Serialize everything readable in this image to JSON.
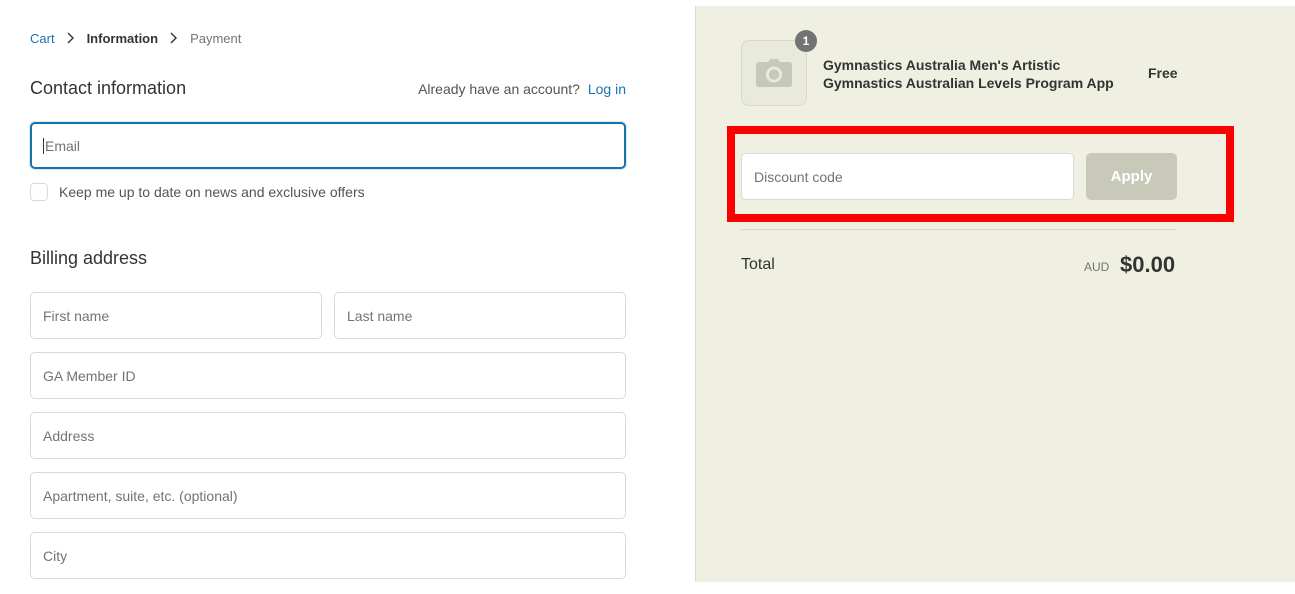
{
  "breadcrumb": {
    "cart": "Cart",
    "information": "Information",
    "payment": "Payment"
  },
  "contact": {
    "title": "Contact information",
    "account_prompt": "Already have an account?",
    "login_label": "Log in",
    "email_placeholder": "Email",
    "newsletter_label": "Keep me up to date on news and exclusive offers",
    "newsletter_checked": false
  },
  "billing": {
    "title": "Billing address",
    "first_name_placeholder": "First name",
    "last_name_placeholder": "Last name",
    "member_id_placeholder": "GA Member ID",
    "address_placeholder": "Address",
    "apartment_placeholder": "Apartment, suite, etc. (optional)",
    "city_placeholder": "City"
  },
  "summary": {
    "product": {
      "quantity": "1",
      "name": "Gymnastics Australia Men's Artistic Gymnastics Australian Levels Program App",
      "price": "Free",
      "image_icon": "camera-icon"
    },
    "discount": {
      "placeholder": "Discount code",
      "apply_label": "Apply"
    },
    "total": {
      "label": "Total",
      "currency": "AUD",
      "amount": "$0.00"
    }
  },
  "colors": {
    "accent": "#1773b0",
    "summary_bg": "#eff0e1",
    "apply_bg": "#c8c9b9",
    "highlight": "#ff0000"
  }
}
